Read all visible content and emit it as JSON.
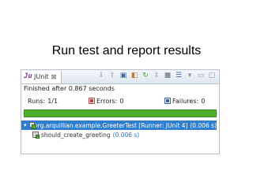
{
  "slide": {
    "title": "Run test and report results"
  },
  "view": {
    "tab_label": "JUnit",
    "tab_close_glyph": "⊠",
    "toolbar_icons": [
      "arrow-down-icon",
      "arrow-up-icon",
      "history-icon",
      "rerun-failed-icon",
      "scroll-lock-icon",
      "stop-icon",
      "layout-icon",
      "view-menu-icon",
      "minimize-icon",
      "maximize-icon"
    ],
    "status": "Finished after 0.867 seconds"
  },
  "counters": {
    "runs_label": "Runs:",
    "runs_value": "1/1",
    "errors_label": "Errors:",
    "errors_value": "0",
    "failures_label": "Failures:",
    "failures_value": "0"
  },
  "progress": {
    "fraction": 1.0,
    "color": "#4caf2e"
  },
  "tree": {
    "suite": {
      "twisty": "▾",
      "label": "org.arquillian.example.GreeterTest [Runner: JUnit 4]",
      "elapsed": "(0.006 s)"
    },
    "tests": [
      {
        "label": "should_create_greeting",
        "elapsed": "(0.006 s)"
      }
    ]
  },
  "colors": {
    "selection": "#2f7fd0",
    "error_square": "#c94040",
    "failure_square": "#3a62a8"
  }
}
